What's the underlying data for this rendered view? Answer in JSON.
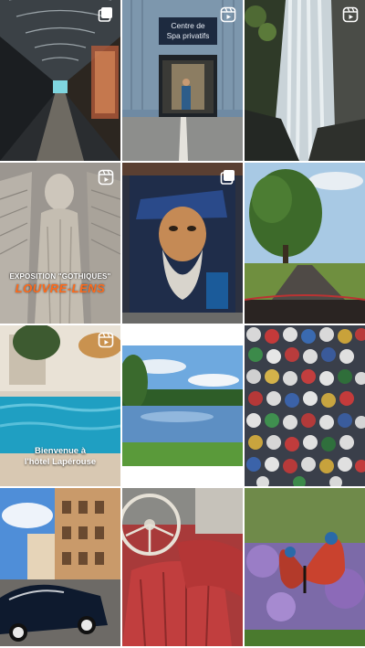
{
  "grid": {
    "tiles": [
      {
        "id": "tunnel",
        "type": "carousel"
      },
      {
        "id": "spa",
        "type": "reel",
        "sign_line1": "Centre de",
        "sign_line2": "Spa privatifs"
      },
      {
        "id": "waterfall",
        "type": "reel"
      },
      {
        "id": "angel-statue",
        "type": "reel",
        "caption_title": "EXPOSITION \"GOTHIQUES\"",
        "caption_sub": "LOUVRE-LENS"
      },
      {
        "id": "street-art",
        "type": "carousel"
      },
      {
        "id": "country-road",
        "type": "photo"
      },
      {
        "id": "pool",
        "type": "reel",
        "caption_line1": "Bienvenue à",
        "caption_line2": "l'hôtel Lapérouse"
      },
      {
        "id": "lake",
        "type": "photo"
      },
      {
        "id": "bottle-caps",
        "type": "photo"
      },
      {
        "id": "vintage-car",
        "type": "photo"
      },
      {
        "id": "car-interior",
        "type": "photo"
      },
      {
        "id": "butterfly",
        "type": "photo"
      }
    ]
  },
  "icons": {
    "reel": "reel-icon",
    "carousel": "carousel-icon"
  },
  "colors": {
    "accent_orange": "#ff6a1a",
    "sign_bg": "#1d2a3f"
  }
}
